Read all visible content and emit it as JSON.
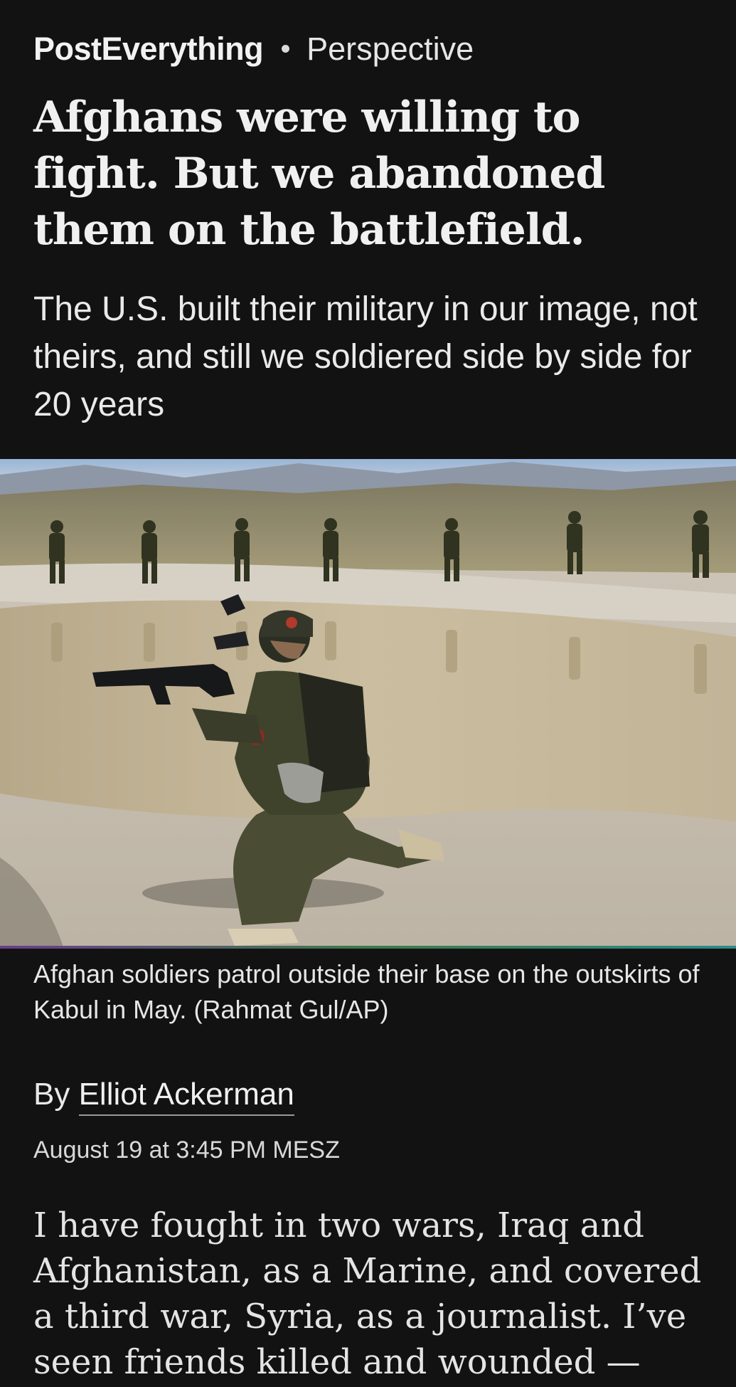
{
  "header": {
    "section": "PostEverything",
    "label": "Perspective"
  },
  "article": {
    "headline": "Afghans were willing to fight. But we abandoned them on the battlefield.",
    "dek": "The U.S. built their military in our image, not theirs, and still we soldiered side by side for 20 years",
    "caption": "Afghan soldiers patrol outside their base on the outskirts of Kabul in May. (Rahmat Gul/AP)",
    "by_prefix": "By ",
    "author": "Elliot Ackerman",
    "timestamp": "August 19 at 3:45 PM MESZ",
    "body": "I have fought in two wars, Iraq and Afghanistan, as a Marine, and covered a third war, Syria, as a journalist. I’ve seen friends killed and wounded —"
  },
  "colors": {
    "background": "#121212",
    "text": "#ebebeb"
  }
}
